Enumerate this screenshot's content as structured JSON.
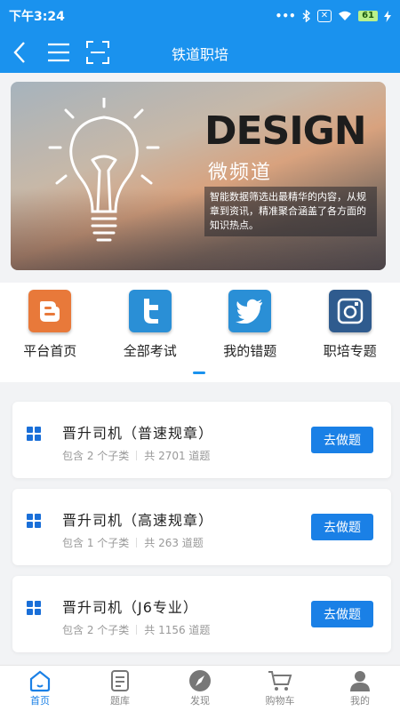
{
  "status": {
    "time": "下午3:24",
    "signal": "•••",
    "battery": "61"
  },
  "appbar": {
    "title": "铁道职培"
  },
  "banner": {
    "headline": "DESIGN",
    "subtitle": "微频道",
    "desc": "智能数据筛选出最精华的内容，从规章到资讯，精准聚合涵盖了各方面的知识热点。"
  },
  "menu": [
    {
      "label": "平台首页",
      "icon": "blogger-icon",
      "color": "#e8793a"
    },
    {
      "label": "全部考试",
      "icon": "twitter-t-icon",
      "color": "#2a8fd6"
    },
    {
      "label": "我的错题",
      "icon": "twitter-bird-icon",
      "color": "#2a8fd6"
    },
    {
      "label": "职培专题",
      "icon": "instagram-icon",
      "color": "#2f5b8e"
    }
  ],
  "cards": [
    {
      "title": "晋升司机（普速规章）",
      "subs": "包含 2 个子类",
      "count": "共 2701 道题",
      "action": "去做题"
    },
    {
      "title": "晋升司机（高速规章）",
      "subs": "包含 1 个子类",
      "count": "共 263 道题",
      "action": "去做题"
    },
    {
      "title": "晋升司机（J6专业）",
      "subs": "包含 2 个子类",
      "count": "共 1156 道题",
      "action": "去做题"
    }
  ],
  "tabs": [
    {
      "label": "首页",
      "icon": "home-icon",
      "active": true
    },
    {
      "label": "题库",
      "icon": "question-bank-icon",
      "active": false
    },
    {
      "label": "发现",
      "icon": "compass-icon",
      "active": false
    },
    {
      "label": "购物车",
      "icon": "cart-icon",
      "active": false
    },
    {
      "label": "我的",
      "icon": "user-icon",
      "active": false
    }
  ],
  "colors": {
    "primary": "#1a92ee",
    "button": "#1a80e6"
  }
}
